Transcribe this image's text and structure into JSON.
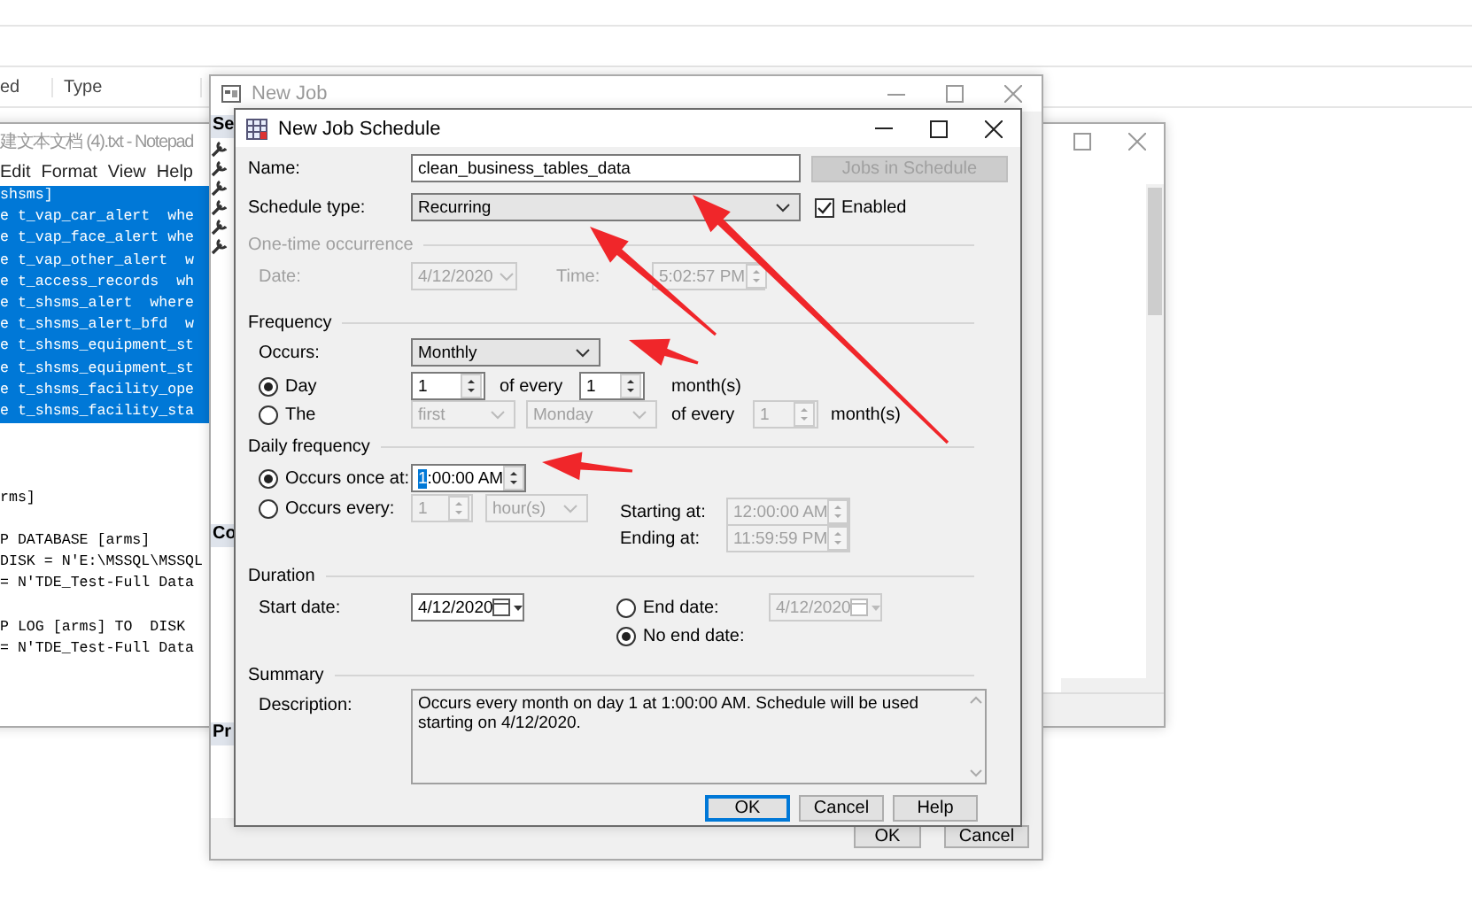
{
  "explorer": {
    "columns": [
      "ed",
      "Type"
    ]
  },
  "notepad": {
    "title": "建文本文档 (4).txt - Notepad",
    "menu": [
      "Edit",
      "Format",
      "View",
      "Help"
    ],
    "selected_lines": [
      "shsms]",
      "e t_vap_car_alert  whe",
      "e t_vap_face_alert whe",
      "e t_vap_other_alert  w",
      "e t_access_records  wh",
      "e t_shsms_alert  where",
      "e t_shsms_alert_bfd  w",
      "e t_shsms_equipment_st",
      "e t_shsms_equipment_st",
      "e t_shsms_facility_ope",
      "e t_shsms_facility_sta"
    ],
    "paragraphs": [
      [
        "rms]"
      ],
      [
        "P DATABASE [arms]",
        "DISK = N'E:\\MSSQL\\MSSQL",
        "= N'TDE_Test-Full Data"
      ],
      [
        "P LOG [arms] TO  DISK",
        "= N'TDE_Test-Full Data"
      ]
    ]
  },
  "new_job": {
    "title": "New Job",
    "pane_headers": [
      "Se",
      "Co",
      "Pr"
    ],
    "buttons": [
      "OK",
      "Cancel"
    ]
  },
  "dialog": {
    "title": "New Job Schedule",
    "name": {
      "label": "Name:",
      "value": "clean_business_tables_data"
    },
    "jobs_button": {
      "label": "Jobs in Schedule",
      "disabled": true
    },
    "schedule_type": {
      "label": "Schedule type:",
      "value": "Recurring"
    },
    "enabled": {
      "label": "Enabled",
      "checked": true
    },
    "one_time": {
      "title": "One-time occurrence",
      "disabled": true,
      "date_label": "Date:",
      "date": "4/12/2020",
      "time_label": "Time:",
      "time": "5:02:57 PM"
    },
    "frequency": {
      "title": "Frequency",
      "occurs_label": "Occurs:",
      "occurs": "Monthly",
      "day_option": {
        "label": "Day",
        "selected": true,
        "day": "1",
        "of_every": "of every",
        "months": "1",
        "unit": "month(s)"
      },
      "the_option": {
        "label": "The",
        "selected": false,
        "ordinal": "first",
        "weekday": "Monday",
        "of_every": "of every",
        "months": "1",
        "unit": "month(s)"
      }
    },
    "daily_frequency": {
      "title": "Daily frequency",
      "once": {
        "label": "Occurs once at:",
        "selected": true,
        "time_selected_part": "1",
        "time_rest": ":00:00 AM"
      },
      "every": {
        "label": "Occurs every:",
        "selected": false,
        "interval": "1",
        "unit": "hour(s)",
        "starting_label": "Starting at:",
        "starting": "12:00:00 AM",
        "ending_label": "Ending at:",
        "ending": "11:59:59 PM"
      }
    },
    "duration": {
      "title": "Duration",
      "start_label": "Start date:",
      "start": "4/12/2020",
      "end_option": {
        "label": "End date:",
        "selected": false,
        "date": "4/12/2020"
      },
      "no_end_option": {
        "label": "No end date:",
        "selected": true
      }
    },
    "summary": {
      "title": "Summary",
      "description_label": "Description:",
      "description": "Occurs every month on day 1 at 1:00:00 AM. Schedule will be used starting on 4/12/2020."
    },
    "buttons": [
      {
        "label": "OK",
        "default": true
      },
      {
        "label": "Cancel",
        "default": false
      },
      {
        "label": "Help",
        "default": false
      }
    ]
  }
}
